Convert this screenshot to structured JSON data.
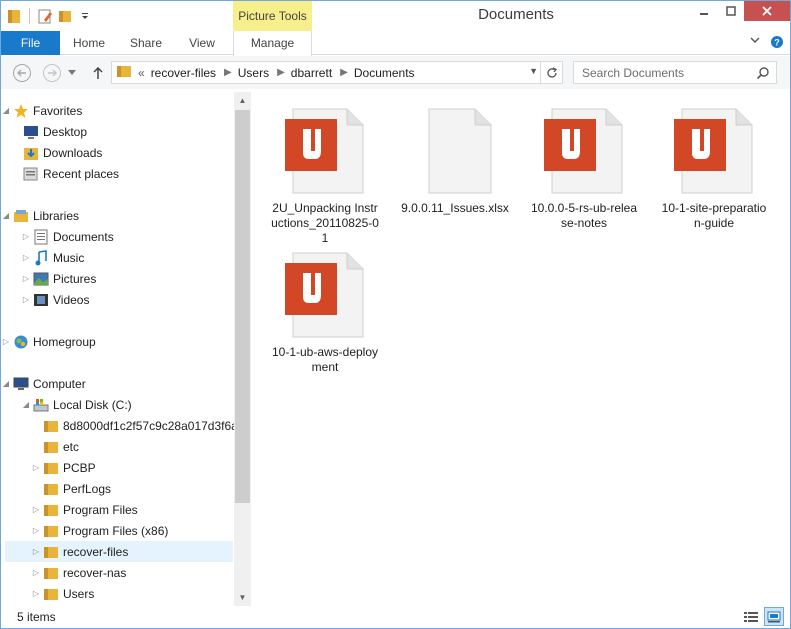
{
  "window": {
    "title": "Documents",
    "contextual_tab_group": "Picture Tools"
  },
  "ribbon": {
    "tabs": [
      {
        "label": "File"
      },
      {
        "label": "Home"
      },
      {
        "label": "Share"
      },
      {
        "label": "View"
      },
      {
        "label": "Manage"
      }
    ]
  },
  "address": {
    "overflow": "«",
    "breadcrumbs": [
      "recover-files",
      "Users",
      "dbarrett",
      "Documents"
    ]
  },
  "search": {
    "placeholder": "Search Documents"
  },
  "navpane": {
    "favorites": {
      "label": "Favorites",
      "items": [
        {
          "label": "Desktop",
          "icon": "desktop-icon"
        },
        {
          "label": "Downloads",
          "icon": "downloads-icon"
        },
        {
          "label": "Recent places",
          "icon": "recent-places-icon"
        }
      ]
    },
    "libraries": {
      "label": "Libraries",
      "items": [
        {
          "label": "Documents",
          "icon": "documents-icon"
        },
        {
          "label": "Music",
          "icon": "music-icon"
        },
        {
          "label": "Pictures",
          "icon": "pictures-icon"
        },
        {
          "label": "Videos",
          "icon": "videos-icon"
        }
      ]
    },
    "homegroup": {
      "label": "Homegroup"
    },
    "computer": {
      "label": "Computer",
      "drive": "Local Disk (C:)",
      "folders": [
        {
          "label": "8d8000df1c2f57c9c28a017d3f6a",
          "expandable": false
        },
        {
          "label": "etc",
          "expandable": false
        },
        {
          "label": "PCBP",
          "expandable": true
        },
        {
          "label": "PerfLogs",
          "expandable": false
        },
        {
          "label": "Program Files",
          "expandable": true
        },
        {
          "label": "Program Files (x86)",
          "expandable": true
        },
        {
          "label": "recover-files",
          "expandable": true,
          "selected": true
        },
        {
          "label": "recover-nas",
          "expandable": true
        },
        {
          "label": "Users",
          "expandable": true
        }
      ]
    }
  },
  "files": [
    {
      "name": "2U_Unpacking Instructions_20110825-01",
      "type": "pdf"
    },
    {
      "name": "9.0.0.11_Issues.xlsx",
      "type": "blank"
    },
    {
      "name": "10.0.0-5-rs-ub-release-notes",
      "type": "pdf"
    },
    {
      "name": "10-1-site-preparation-guide",
      "type": "pdf"
    },
    {
      "name": "10-1-ub-aws-deployment",
      "type": "pdf"
    }
  ],
  "status": {
    "item_count": "5 items"
  },
  "colors": {
    "accent": "#1979ca",
    "pdf_red": "#d24726",
    "contextual_yellow": "#f7ef8c",
    "close_red": "#c75050",
    "selection": "#e5f3ff"
  }
}
